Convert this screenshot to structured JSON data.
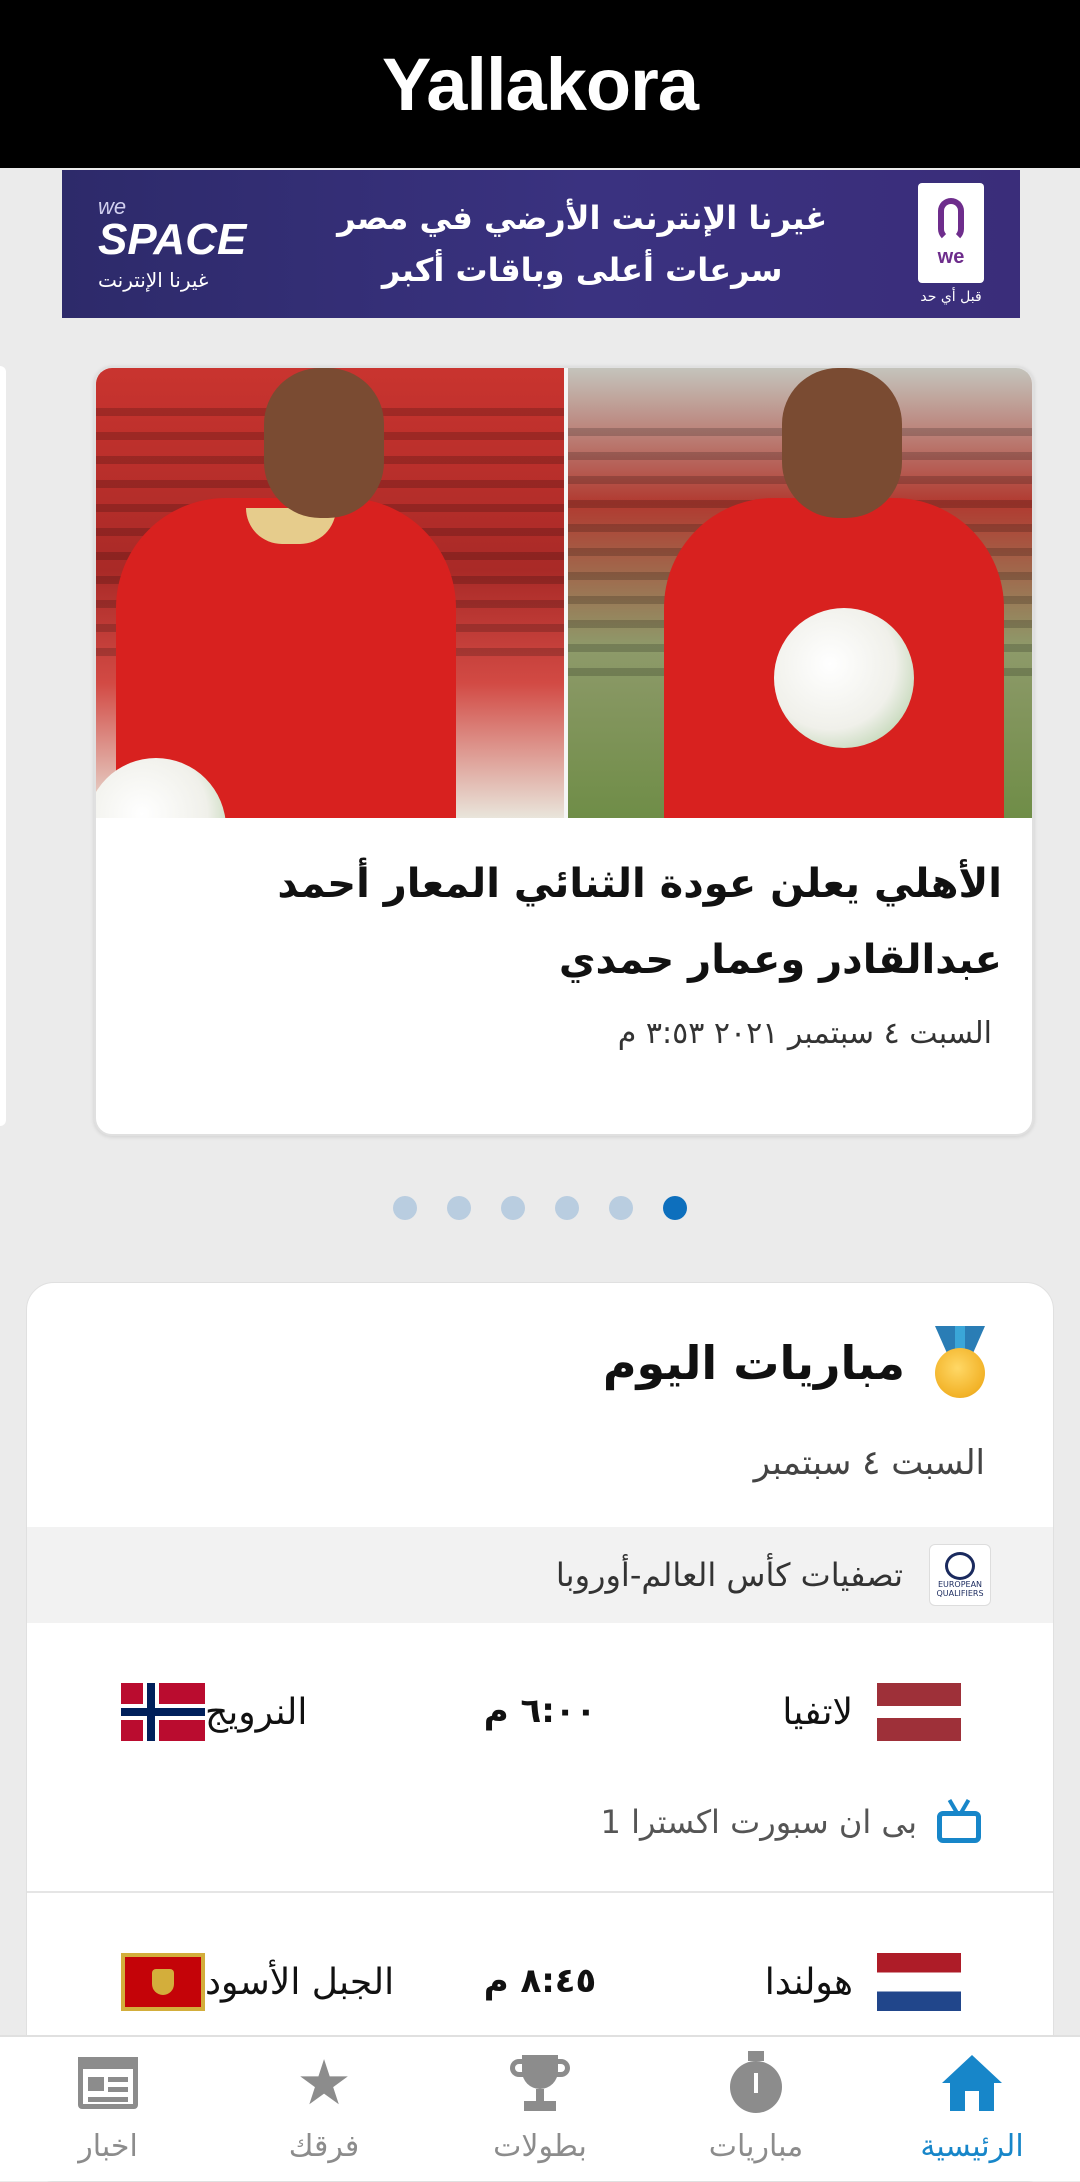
{
  "header": {
    "logo_text": "Yallakora"
  },
  "ad_banner": {
    "brand_small": "we",
    "brand": "SPACE",
    "brand_sub": "غيرنا الإنترنت",
    "line1": "غيرنا الإنترنت الأرضي في مصر",
    "line2": "سرعات أعلى وباقات أكبر",
    "operator": "we",
    "operator_tag": "قبل أي حد"
  },
  "featured": {
    "title": "الأهلي يعلن عودة الثنائي المعار أحمد عبدالقادر وعمار حمدي",
    "date": "السبت ٤ سبتمبر ٢٠٢١ ٣:٥٣ م",
    "dots_count": 6,
    "active_dot": 6
  },
  "matches": {
    "title": "مباريات اليوم",
    "date": "السبت ٤ سبتمبر",
    "league": {
      "name": "تصفيات كأس العالم-أوروبا",
      "logo_text": "EUROPEAN QUALIFIERS"
    },
    "rows": [
      {
        "home": "لاتفيا",
        "away": "النرويج",
        "time": "٦:٠٠ م",
        "channel": "بى ان سبورت اكسترا 1"
      },
      {
        "home": "هولندا",
        "away": "الجبل الأسود",
        "time": "٨:٤٥ م",
        "channel": ""
      }
    ]
  },
  "bottom_nav": {
    "items": [
      {
        "label": "الرئيسية",
        "icon": "home-icon",
        "active": true
      },
      {
        "label": "مباريات",
        "icon": "stopwatch-icon",
        "active": false
      },
      {
        "label": "بطولات",
        "icon": "trophy-icon",
        "active": false
      },
      {
        "label": "فرقك",
        "icon": "star-icon",
        "active": false
      },
      {
        "label": "اخبار",
        "icon": "news-icon",
        "active": false
      }
    ]
  },
  "colors": {
    "accent": "#1786c9",
    "header_bg": "#000000",
    "page_bg": "#ebebeb",
    "inactive": "#8c8c8c"
  }
}
